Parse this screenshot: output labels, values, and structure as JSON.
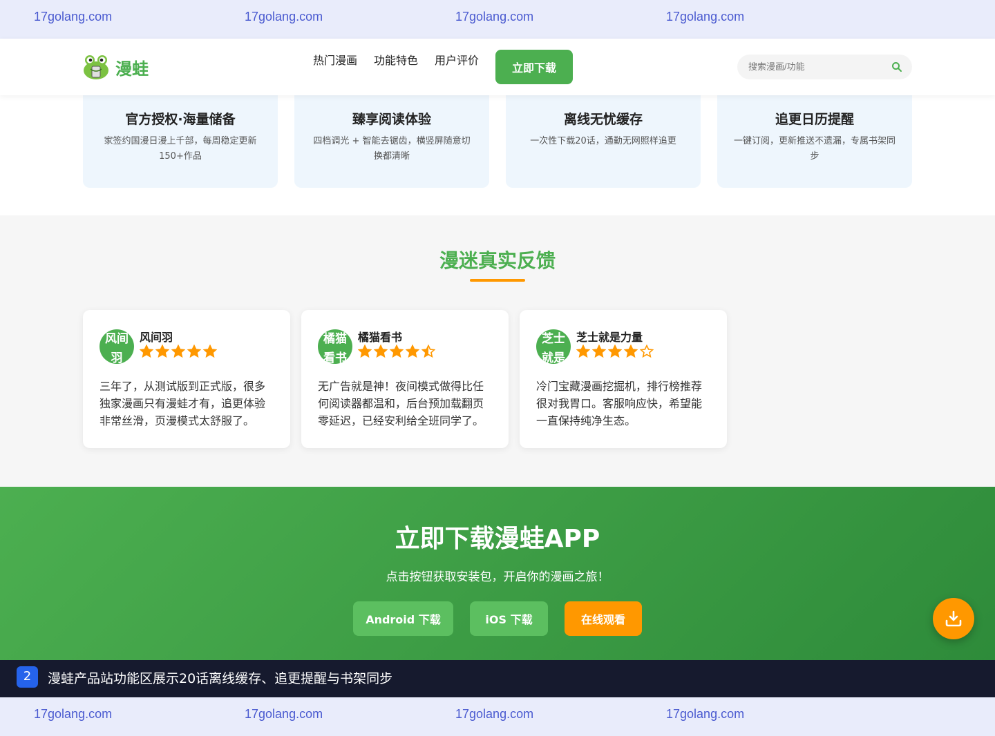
{
  "watermark": {
    "text": "17golang.com"
  },
  "header": {
    "logo_text": "漫蛙",
    "nav": [
      "热门漫画",
      "功能特色",
      "用户评价"
    ],
    "download_button": "立即下载",
    "search_placeholder": "搜索漫画/功能"
  },
  "features": [
    {
      "title": "官方授权·海量储备",
      "desc": "家签约国漫日漫上千部，每周稳定更新150+作品"
    },
    {
      "title": "臻享阅读体验",
      "desc": "四档调光 + 智能去锯齿，横竖屏随意切换都清晰"
    },
    {
      "title": "离线无忧缓存",
      "desc": "一次性下载20话，通勤无网照样追更"
    },
    {
      "title": "追更日历提醒",
      "desc": "一键订阅，更新推送不遗漏，专属书架同步"
    }
  ],
  "reviews_section": {
    "title": "漫迷真实反馈"
  },
  "reviews": [
    {
      "avatar_text": "风间羽",
      "name": "风间羽",
      "rating": 5,
      "text": "三年了，从测试版到正式版，很多独家漫画只有漫蛙才有，追更体验非常丝滑，页漫模式太舒服了。"
    },
    {
      "avatar_text": "橘猫看书",
      "name": "橘猫看书",
      "rating": 4.5,
      "text": "无广告就是神！夜间模式做得比任何阅读器都温和，后台预加载翻页零延迟，已经安利给全班同学了。"
    },
    {
      "avatar_text": "芝士就是力量",
      "name": "芝士就是力量",
      "rating": 4,
      "text": "冷门宝藏漫画挖掘机，排行榜推荐很对我胃口。客服响应快，希望能一直保持纯净生态。"
    }
  ],
  "cta": {
    "title": "立即下载漫蛙APP",
    "subtitle": "点击按钮获取安装包，开启你的漫画之旅！",
    "android": "Android 下载",
    "ios": "iOS 下载",
    "online": "在线观看"
  },
  "caption": {
    "number": "2",
    "text": "漫蛙产品站功能区展示20话离线缓存、追更提醒与书架同步"
  },
  "colors": {
    "primary": "#4caf50",
    "accent": "#ff9800",
    "watermark": "#4a5ad0"
  }
}
